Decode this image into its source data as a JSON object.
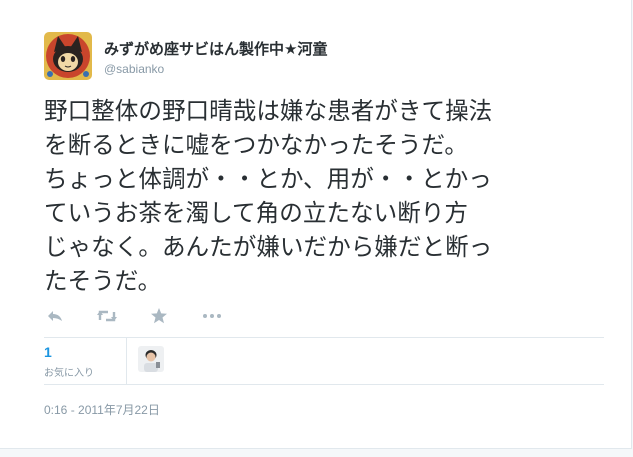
{
  "user": {
    "display_name": "みずがめ座サビはん製作中★河童",
    "handle": "@sabianko"
  },
  "tweet": {
    "lines": [
      "野口整体の野口晴哉は嫌な患者がきて操法",
      "を断るときに嘘をつかなかったそうだ。",
      "ちょっと体調が・・とか、用が・・とかっ",
      "ていうお茶を濁して角の立たない断り方",
      "じゃなく。あんたが嫌いだから嫌だと断っ",
      "たそうだ。"
    ]
  },
  "actions": {
    "icons": [
      "reply-icon",
      "retweet-icon",
      "favorite-icon",
      "more-icon"
    ]
  },
  "stats": {
    "favorites_count": "1",
    "favorites_label": "お気に入り"
  },
  "timestamp": "0:16 - 2011年7月22日",
  "colors": {
    "text": "#292f33",
    "muted": "#8899a6",
    "link": "#1b95e0",
    "icon": "#aab8c2",
    "divider": "#e1e8ed"
  }
}
